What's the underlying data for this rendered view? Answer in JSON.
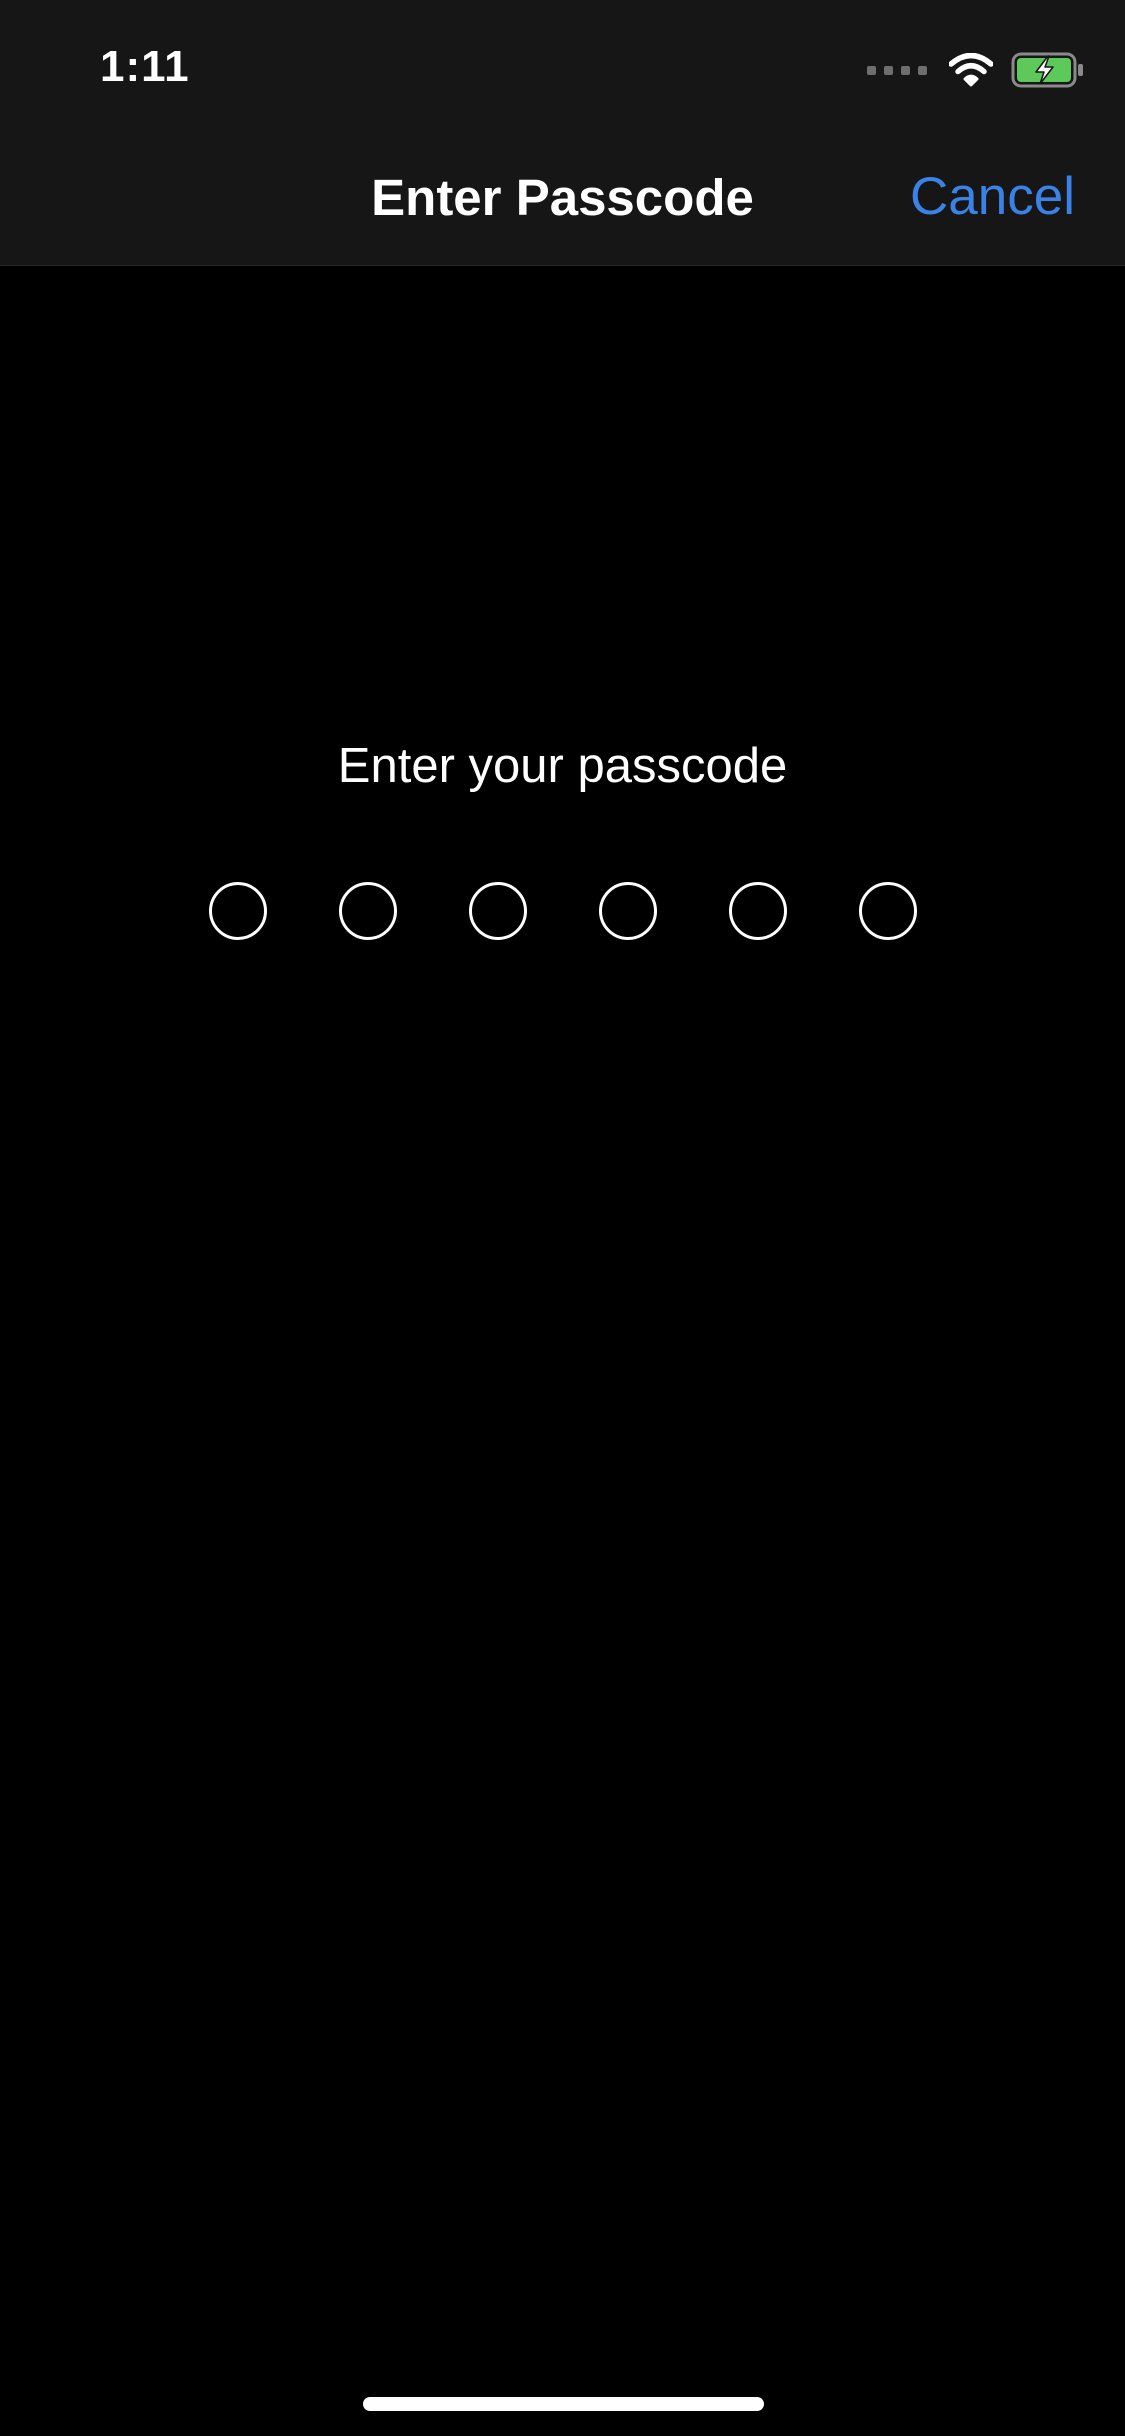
{
  "status_bar": {
    "time": "1:11",
    "icons": [
      "cellular-signal-icon",
      "wifi-icon",
      "battery-charging-icon"
    ],
    "battery_color": "#5ec95b"
  },
  "nav": {
    "title": "Enter Passcode",
    "cancel_label": "Cancel",
    "accent_color": "#3b82e6"
  },
  "passcode": {
    "prompt": "Enter your passcode",
    "length": 6,
    "entered": 0
  }
}
